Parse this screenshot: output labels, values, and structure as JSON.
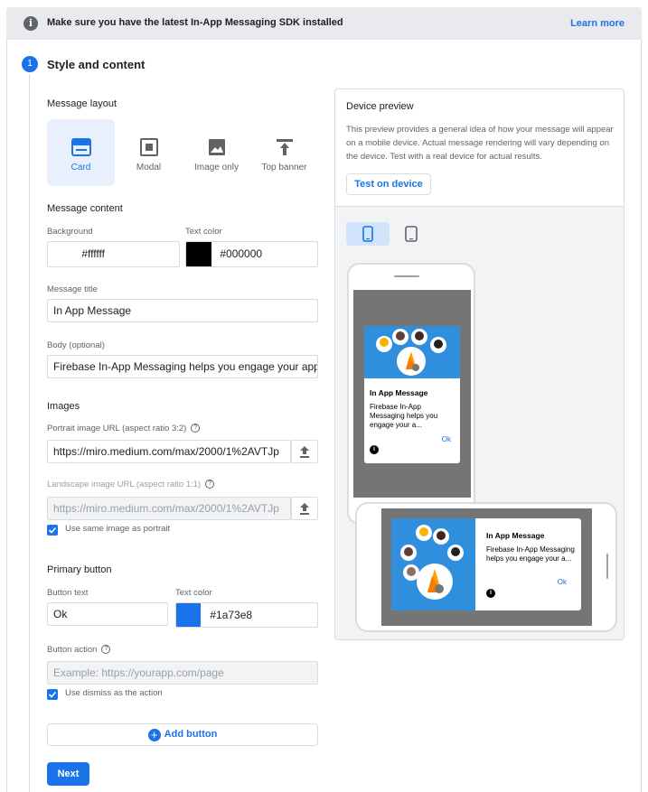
{
  "banner": {
    "message": "Make sure you have the latest In-App Messaging SDK installed",
    "learn_more": "Learn more",
    "info_glyph": "i"
  },
  "step": {
    "number": "1",
    "title": "Style and content"
  },
  "layout": {
    "label": "Message layout",
    "options": [
      {
        "label": "Card",
        "selected": true
      },
      {
        "label": "Modal",
        "selected": false
      },
      {
        "label": "Image only",
        "selected": false
      },
      {
        "label": "Top banner",
        "selected": false
      }
    ]
  },
  "content": {
    "label": "Message content",
    "background_label": "Background",
    "background_value": "#ffffff",
    "background_color": "#ffffff",
    "text_color_label": "Text color",
    "text_color_value": "#000000",
    "text_color_swatch": "#000000",
    "title_label": "Message title",
    "title_value": "In App Message",
    "body_label": "Body (optional)",
    "body_value": "Firebase In-App Messaging helps you engage your app"
  },
  "images": {
    "label": "Images",
    "portrait_label": "Portrait image URL (aspect ratio 3:2)",
    "portrait_value": "https://miro.medium.com/max/2000/1%2AVTJp",
    "landscape_label": "Landscape image URL (aspect ratio 1:1)",
    "landscape_placeholder": "https://miro.medium.com/max/2000/1%2AVTJp",
    "same_image_label": "Use same image as portrait",
    "same_image_checked": true
  },
  "primary_button": {
    "label": "Primary button",
    "text_label": "Button text",
    "text_value": "Ok",
    "color_label": "Text color",
    "color_value": "#1a73e8",
    "color_swatch": "#1a73e8",
    "action_label": "Button action",
    "action_placeholder": "Example: https://yourapp.com/page",
    "dismiss_label": "Use dismiss as the action",
    "dismiss_checked": true
  },
  "add_button": {
    "plus_glyph": "+",
    "label": "Add button"
  },
  "next_button": "Next",
  "help_glyph": "?",
  "preview": {
    "title": "Device preview",
    "description": "This preview provides a general idea of how your message will appear on a mobile device. Actual message rendering will vary depending on the device. Test with a real device for actual results.",
    "test_button": "Test on device",
    "card_title": "In App Message",
    "card_body": "Firebase In-App Messaging helps you engage your a...",
    "card_ok": "Ok",
    "dismiss_glyph": "i",
    "image_color": "#2f8fdc"
  },
  "colors": {
    "accent": "#1a73e8",
    "selected_bg": "#e8f0fe",
    "banner_bg": "#e8eaed"
  }
}
